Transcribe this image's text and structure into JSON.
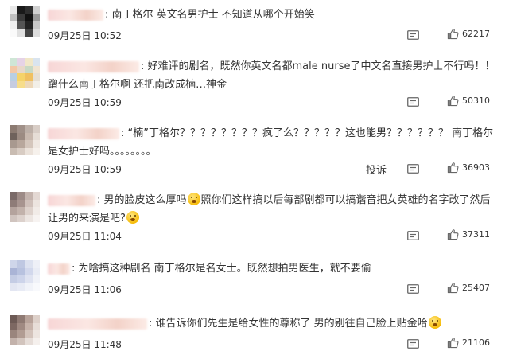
{
  "comments": [
    {
      "lead": ":",
      "text": "南丁格尔 英文名男护士 不知道从哪个开始笑",
      "time": "09月25日 10:52",
      "likes": "62217",
      "avatar_colors": [
        "#e8e8e8",
        "#1a1a1a",
        "#2e2e2e",
        "#d0d0d0",
        "#bfbfbf",
        "#3a3a3a",
        "#111",
        "#9a9a9a",
        "#f0f0f0",
        "#555",
        "#222",
        "#c8c8c8",
        "#fafafa",
        "#e0e0e0",
        "#444",
        "#ddd"
      ],
      "name_width": 70
    },
    {
      "lead": ":",
      "text": "好难评的剧名，既然你英文名都male nurse了中文名直接男护士不行吗！！蹭什么南丁格尔啊 还把南改成楠…神金",
      "time": "09月25日 10:59",
      "likes": "50310",
      "avatar_colors": [
        "#cfe6d6",
        "#e6d3e6",
        "#f1e7c8",
        "#d9e4ef",
        "#f3c8a6",
        "#e8d8c9",
        "#c8d9c4",
        "#f0e4d2",
        "#b9cfe2",
        "#f5d36a",
        "#f0c060",
        "#e6dfd3",
        "#c6cce0",
        "#f7dd8a",
        "#edd8b8",
        "#f2efe8"
      ],
      "name_width": 115
    },
    {
      "lead": ":",
      "text": "“楠”丁格尔？？？？？？？？疯了么？？？？？这也能男？？？？？？ 南丁格尔是女护士好吗。。。。。。。。",
      "time": "09月25日 10:59",
      "likes": "36903",
      "report": "投诉",
      "avatar_colors": [
        "#8c7b72",
        "#a09088",
        "#bdb0a8",
        "#d8cdc6",
        "#6f625c",
        "#9c8b82",
        "#c8b8ae",
        "#e6ddd6",
        "#a8998f",
        "#b8a79c",
        "#d4c6bc",
        "#efe8e2",
        "#c9bcb2",
        "#d8ccc3",
        "#ebe2da",
        "#f6f1ec"
      ],
      "name_width": 90
    },
    {
      "lead": ":",
      "text": "男的脸皮这么厚吗",
      "text2": "照你们这样搞以后每部剧都可以搞谐音把女英雄的名字改了然后让男的来演是吧?",
      "time": "09月25日 11:04",
      "likes": "37311",
      "avatar_colors": [
        "#7a6a68",
        "#9d8b87",
        "#c4b4ae",
        "#e3d8d3",
        "#8e7c78",
        "#a7948f",
        "#cfc0ba",
        "#ece4df",
        "#b4a39d",
        "#c2b2ab",
        "#ddd1cb",
        "#f1ebe7",
        "#d0c4bf",
        "#dcd1cc",
        "#ece5e1",
        "#f7f3f1"
      ],
      "name_width": 60
    },
    {
      "lead": ":",
      "text": "为啥搞这种剧名 南丁格尔是名女士。既然想拍男医生，就不要偷",
      "time": "09月25日 11:06",
      "likes": "25407",
      "avatar_colors": [
        "#cfd6ea",
        "#bfc8e2",
        "#dde2f0",
        "#eef0f7",
        "#aab4d6",
        "#b8c2df",
        "#d2d8ec",
        "#e9ecf5",
        "#c4cce4",
        "#cdd4ea",
        "#dfe3f1",
        "#f0f2f8",
        "#e3e6f2",
        "#e8ebf5",
        "#f1f3f9",
        "#f8f9fc"
      ],
      "name_width": 28
    },
    {
      "lead": ":",
      "text": "谁告诉你们先生是给女性的尊称了 男的别往自己脸上贴金哈",
      "time": "09月25日 11:48",
      "likes": "21106",
      "avatar_colors": [
        "#6d5a55",
        "#8f7a73",
        "#b8a39a",
        "#ddd0c9",
        "#7d6862",
        "#a08a82",
        "#c7b3aa",
        "#e7ddd7",
        "#9a857d",
        "#b19c93",
        "#d3c3bb",
        "#ede5e0",
        "#c3b2ab",
        "#d2c4bd",
        "#e6ddd8",
        "#f5f0ed"
      ],
      "name_width": 125
    }
  ],
  "icons": {
    "reply": "comment-icon",
    "like": "thumbs-up-icon"
  }
}
